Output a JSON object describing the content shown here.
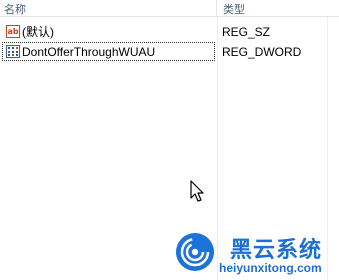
{
  "columns": {
    "name": "名称",
    "type": "类型"
  },
  "rows": [
    {
      "icon": "string-value-icon",
      "name": "(默认)",
      "type": "REG_SZ",
      "selected": false
    },
    {
      "icon": "binary-value-icon",
      "name": "DontOfferThroughWUAU",
      "type": "REG_DWORD",
      "selected": true
    }
  ],
  "watermark": {
    "chinese": "黑云系统",
    "url": "heiyunxitong.com",
    "logo": "swirl-logo-icon",
    "color": "#1c6fd3"
  }
}
